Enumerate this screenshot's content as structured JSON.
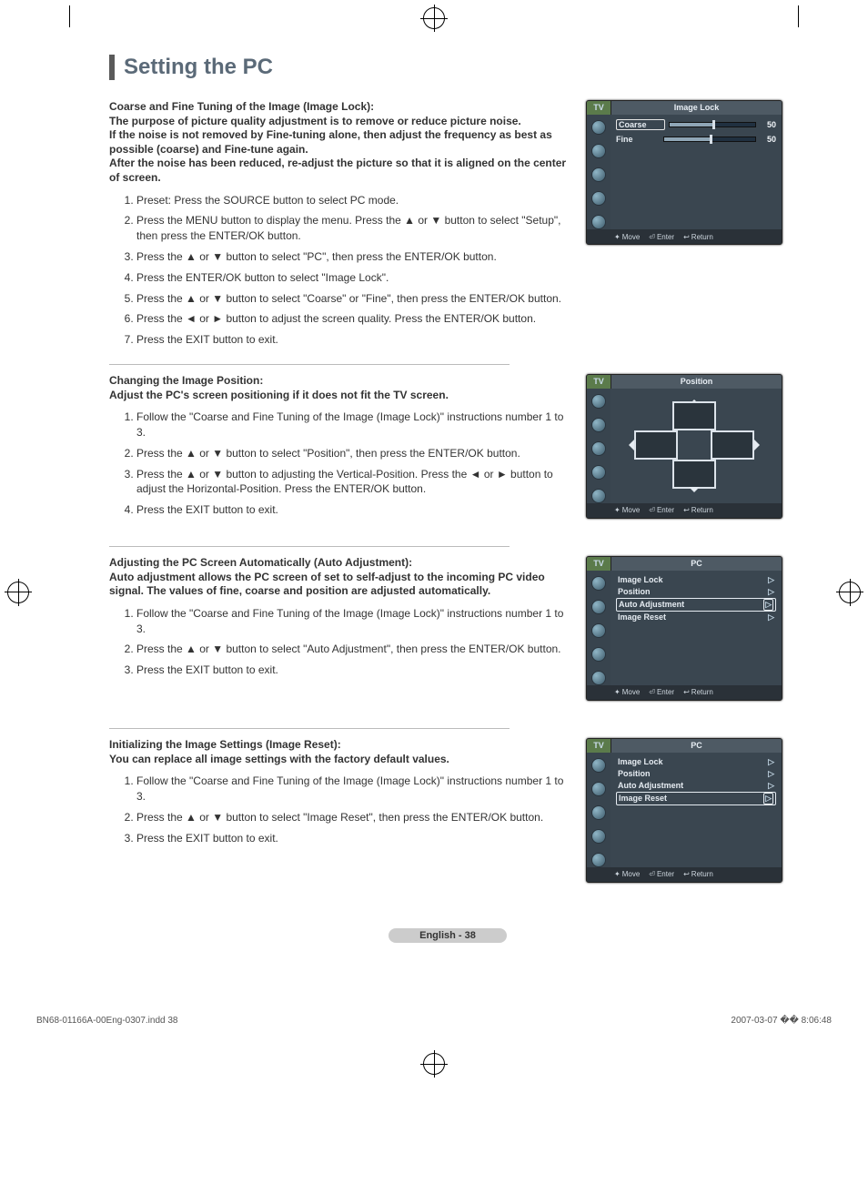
{
  "title": "Setting the PC",
  "sections": [
    {
      "intro": "Coarse and Fine Tuning of the Image (Image Lock):\nThe purpose of picture quality adjustment is to remove or reduce picture noise.\nIf the noise is not removed by Fine-tuning alone, then adjust the frequency as best as possible (coarse) and Fine-tune again.\nAfter the noise has been reduced, re-adjust the picture so that it is aligned on the center of screen.",
      "steps": [
        "Preset: Press the SOURCE button to select PC mode.",
        "Press the MENU button to display the menu. Press the ▲ or ▼ button to select \"Setup\", then press the ENTER/OK button.",
        "Press the ▲ or ▼ button to select \"PC\", then press the ENTER/OK button.",
        "Press the ENTER/OK button to select \"Image Lock\".",
        "Press the  ▲ or ▼ button to select \"Coarse\" or \"Fine\", then press the ENTER/OK button.",
        "Press the ◄ or ► button to adjust the screen quality. Press the ENTER/OK button.",
        "Press the EXIT button to exit."
      ]
    },
    {
      "intro": "Changing the Image Position:\nAdjust the PC's screen positioning if it does not fit the TV screen.",
      "steps": [
        "Follow the \"Coarse and Fine Tuning of the Image (Image Lock)\" instructions number 1 to 3.",
        "Press the ▲ or ▼ button to select \"Position\", then press the ENTER/OK button.",
        "Press the ▲ or ▼ button to adjusting the Vertical-Position. Press the ◄ or ► button to adjust the Horizontal-Position. Press the ENTER/OK button.",
        "Press the EXIT button to exit."
      ]
    },
    {
      "intro": "Adjusting the PC Screen Automatically (Auto Adjustment):\nAuto adjustment allows the PC screen of set to self-adjust to the incoming PC video signal. The values of fine, coarse and position are adjusted automatically.",
      "steps": [
        "Follow the \"Coarse and Fine Tuning of the Image (Image Lock)\"  instructions number 1 to 3.",
        "Press the ▲ or ▼ button to select \"Auto Adjustment\", then press the ENTER/OK button.",
        "Press the EXIT button to exit."
      ]
    },
    {
      "intro": "Initializing the Image Settings (Image Reset):\nYou can replace all image settings with the factory default values.",
      "steps": [
        "Follow the \"Coarse and Fine Tuning of the Image (Image Lock)\"  instructions number 1 to 3.",
        "Press the ▲ or ▼ button to select \"Image Reset\", then press the ENTER/OK button.",
        "Press the EXIT button to exit."
      ]
    }
  ],
  "osd": {
    "tv": "TV",
    "footer": {
      "move": "Move",
      "enter": "Enter",
      "return": "Return"
    },
    "imageLock": {
      "caption": "Image Lock",
      "rows": [
        {
          "label": "Coarse",
          "value": "50",
          "selected": true
        },
        {
          "label": "Fine",
          "value": "50",
          "selected": false
        }
      ]
    },
    "position": {
      "caption": "Position"
    },
    "pc1": {
      "caption": "PC",
      "items": [
        {
          "label": "Image Lock",
          "selected": false
        },
        {
          "label": "Position",
          "selected": false
        },
        {
          "label": "Auto Adjustment",
          "selected": true
        },
        {
          "label": "Image Reset",
          "selected": false
        }
      ]
    },
    "pc2": {
      "caption": "PC",
      "items": [
        {
          "label": "Image Lock",
          "selected": false
        },
        {
          "label": "Position",
          "selected": false
        },
        {
          "label": "Auto Adjustment",
          "selected": false
        },
        {
          "label": "Image Reset",
          "selected": true
        }
      ]
    }
  },
  "pageLabel": "English - 38",
  "footer": {
    "left": "BN68-01166A-00Eng-0307.indd   38",
    "right": "2007-03-07   �� 8:06:48"
  }
}
